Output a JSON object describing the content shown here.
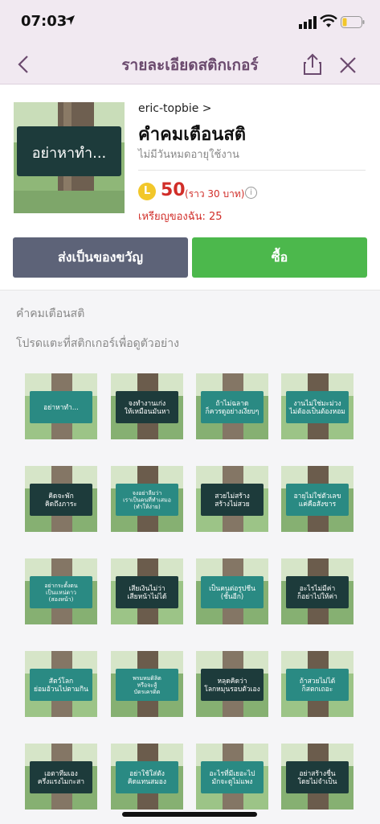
{
  "status": {
    "time": "07:03"
  },
  "nav": {
    "title": "รายละเอียดสติกเกอร์"
  },
  "product": {
    "image_text": "อย่าหาทำ...",
    "author": "eric-topbie",
    "author_chevron": ">",
    "title": "คำคมเตือนสติ",
    "subtitle": "ไม่มีวันหมดอายุใช้งาน",
    "coin_symbol": "L",
    "price": "50",
    "price_note": "(ราว  30 บาท)",
    "info_symbol": "i",
    "coins_left": "เหรียญของฉัน: 25"
  },
  "buttons": {
    "gift": "ส่งเป็นของขวัญ",
    "buy": "ซื้อ"
  },
  "section": {
    "title": "คำคมเตือนสติ",
    "hint": "โปรดแตะที่สติกเกอร์เพื่อดูตัวอย่าง"
  },
  "stickers": [
    "อย่าหาทำ...",
    "จงทำงานเก่ง ให้เหมือนมันหา",
    "ถ้าไม่ฉลาด ก็ควรดูอย่างเงียบๆ",
    "งานไม่ใช่มะม่วง ไม่ต้องเป็นต้องหอม",
    "คิดจะพัก คิดถึงภาระ",
    "จงอย่าลืมว่า เราเป็นคนที่ทำเสมอ (ทำให้ง่าย)",
    "สวยไม่สร้าง สร้างไม่สวย",
    "อายุไม่ใช่ตัวเลข แค่คือสังขาร",
    "อย่ากระตั้งตน เป็นแหน่ดาว (สองหน้า)",
    "เสียเงินไม่ว่า เสียหน้าไม่ได้",
    "เป็นคนต่อรูปชีน (ชั้นอีก)",
    "อะไรไม่มีค่า ก็อย่าไปให้ค่า",
    "สัตว์โลก ย่อมอ้วนไปตามกิน",
    "พรมหมดิลิต หรือจะสู้ บัตรเครดิต",
    "หลุดคิดว่า โลกหมุนรอบตัวเอง",
    "ถ้าสวยไม่ได้ ก็สตกเถอะ",
    "เอตาทีมเอง ครึ่งแรงไมกะสา",
    "อย่าใช้ใส่ตัง คิดแทนสมอง",
    "อะไรที่มีเยอะไป มักจะดูไม่แพง",
    "อย่าสร้างชื่น โดยไม่จำเป็น"
  ],
  "colors": {
    "header_bg": "#f1e9f1",
    "title_color": "#6b4a6e",
    "price_red": "#d12d28",
    "gift_button": "#5d6378",
    "buy_button": "#4cb84c",
    "coin_gold": "#f2c72a",
    "sign_dark": "#1d3b3b",
    "sign_teal": "#2a8a83"
  },
  "icons": {
    "location": "location-arrow-icon",
    "signal": "signal-bars-icon",
    "wifi": "wifi-icon",
    "battery": "battery-low-icon",
    "back": "chevron-left-icon",
    "share": "share-icon",
    "close": "close-icon"
  }
}
